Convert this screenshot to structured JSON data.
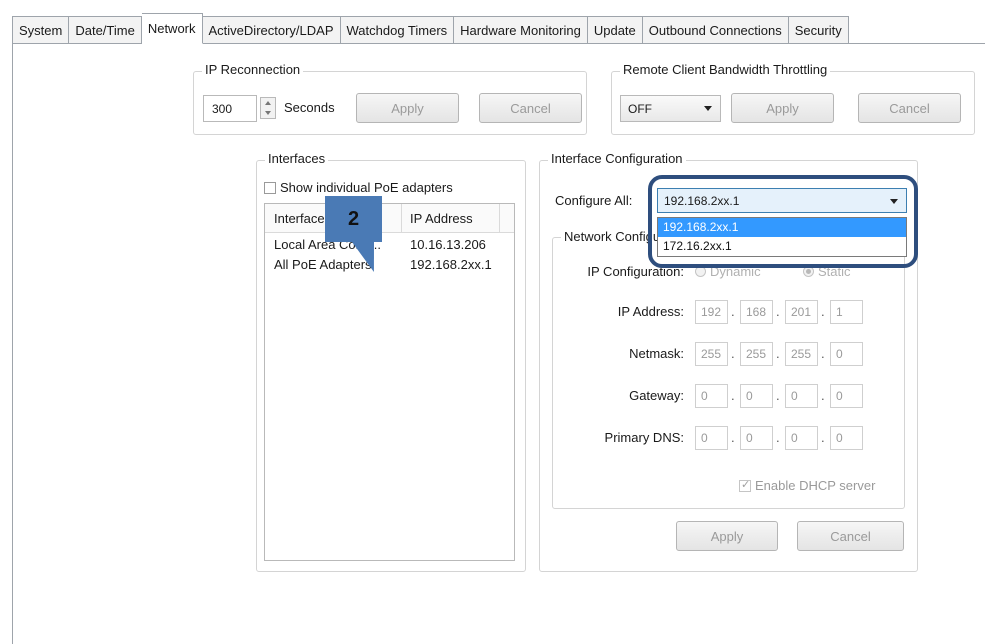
{
  "tabs": [
    "System",
    "Date/Time",
    "Network",
    "ActiveDirectory/LDAP",
    "Watchdog Timers",
    "Hardware Monitoring",
    "Update",
    "Outbound Connections",
    "Security"
  ],
  "ip_reconnection": {
    "title": "IP Reconnection",
    "value": "300",
    "unit": "Seconds",
    "apply": "Apply",
    "cancel": "Cancel"
  },
  "throttling": {
    "title": "Remote Client Bandwidth Throttling",
    "value": "OFF",
    "apply": "Apply",
    "cancel": "Cancel"
  },
  "interfaces": {
    "title": "Interfaces",
    "show_poe_label": "Show individual PoE adapters",
    "columns": [
      "Interface",
      "IP Address"
    ],
    "rows": [
      {
        "name": "Local Area Conn...",
        "ip": "10.16.13.206"
      },
      {
        "name": "All PoE Adapters",
        "ip": "192.168.2xx.1"
      }
    ]
  },
  "callout": {
    "number": "2"
  },
  "config": {
    "title": "Interface Configuration",
    "configure_all_label": "Configure All:",
    "configure_all_value": "192.168.2xx.1",
    "dropdown_options": [
      "192.168.2xx.1",
      "172.16.2xx.1"
    ],
    "network_group_title": "Network Configuration",
    "ip_config_label": "IP Configuration:",
    "dynamic_label": "Dynamic",
    "static_label": "Static",
    "ip_address_label": "IP Address:",
    "ip_address": [
      "192",
      "168",
      "201",
      "1"
    ],
    "netmask_label": "Netmask:",
    "netmask": [
      "255",
      "255",
      "255",
      "0"
    ],
    "gateway_label": "Gateway:",
    "gateway": [
      "0",
      "0",
      "0",
      "0"
    ],
    "dns_label": "Primary DNS:",
    "dns": [
      "0",
      "0",
      "0",
      "0"
    ],
    "dhcp_label": "Enable DHCP server",
    "apply": "Apply",
    "cancel": "Cancel"
  },
  "colors": {
    "highlight": "#3399ff",
    "callout": "#4a7ab5",
    "frame": "#2e4e7e"
  }
}
